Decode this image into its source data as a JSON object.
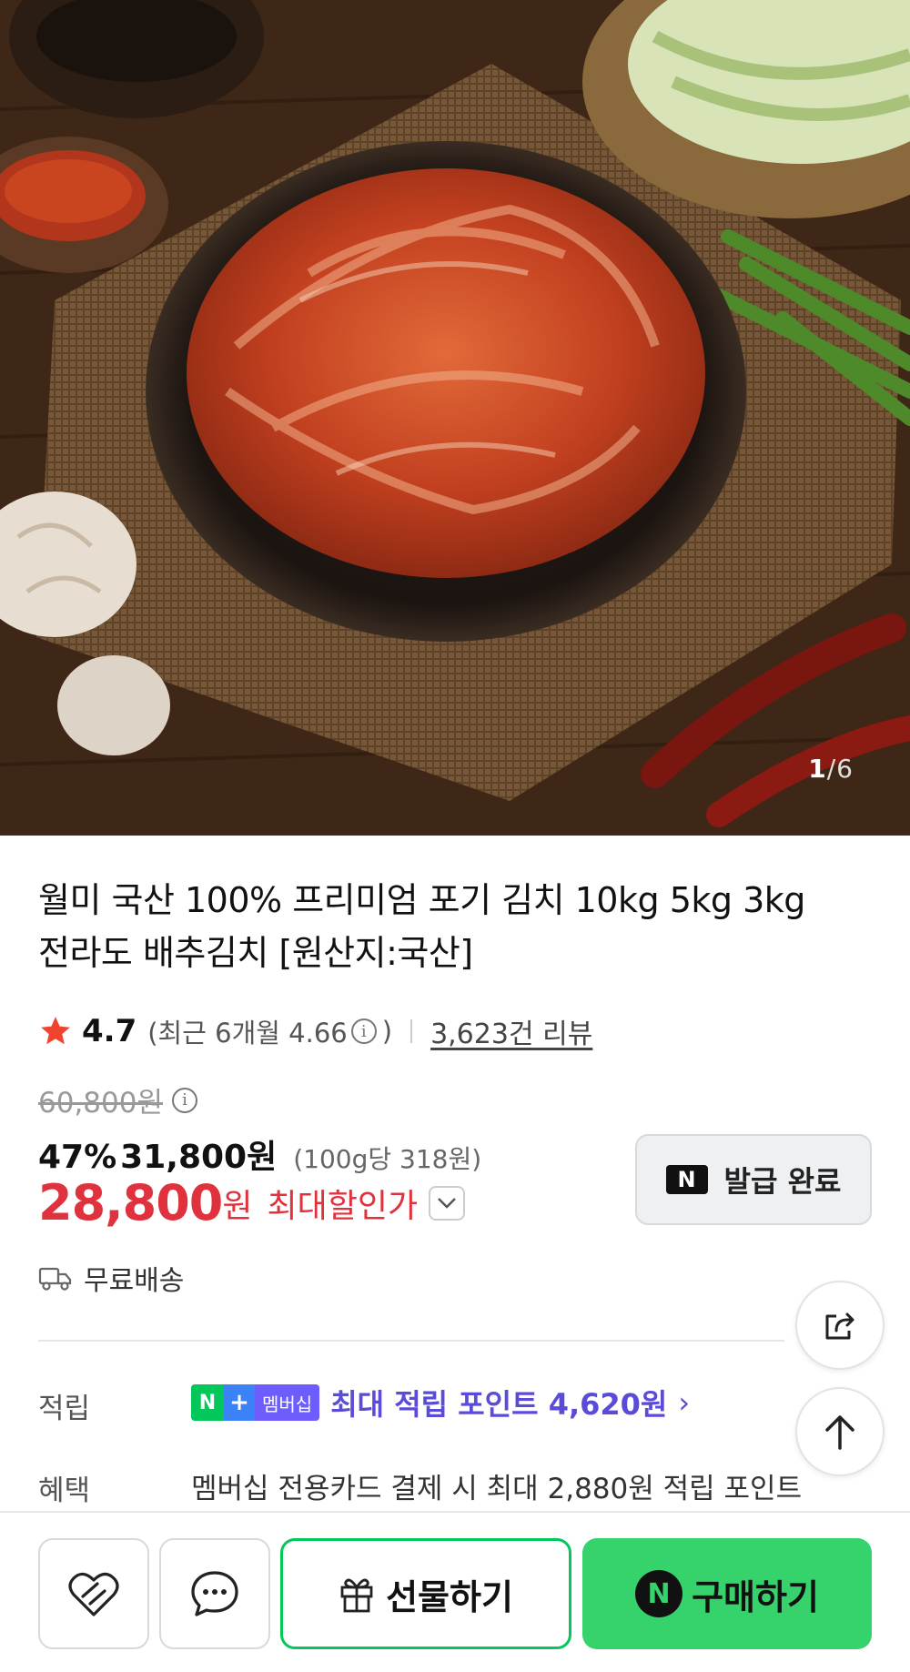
{
  "image": {
    "counter_current": "1",
    "counter_total": "/6"
  },
  "product": {
    "title_line1": "월미 국산 100% 프리미엄 포기 김치 10kg 5kg 3kg",
    "title_line2": "전라도 배추김치 [원산지:국산]"
  },
  "rating": {
    "value": "4.7",
    "recent_prefix": "(최근 6개월 4.66",
    "recent_suffix": ")",
    "reviews": "3,623건 리뷰"
  },
  "price": {
    "original": "60,800원",
    "discount_pct": "47%",
    "sale": "31,800원",
    "unit": "(100g당 318원)",
    "final": "28,800",
    "final_won": "원",
    "final_label": "최대할인가"
  },
  "coupon": {
    "badge": "N",
    "label": "발급 완료"
  },
  "shipping": {
    "label": "무료배송"
  },
  "points": {
    "label": "적립",
    "badge_n": "N",
    "badge_plus": "+",
    "badge_membership": "멤버십",
    "text": "최대 적립 포인트 4,620원",
    "chevron": "›"
  },
  "benefit": {
    "label": "혜택",
    "text": "멤버십 전용카드 결제 시 최대 2,880원 적립 포인트"
  },
  "bottom_bar": {
    "gift_label": "선물하기",
    "buy_badge": "N",
    "buy_label": "구매하기"
  },
  "icons": {
    "like": "heart-icon",
    "talk": "chat-icon",
    "gift": "gift-icon",
    "share": "share-icon",
    "top": "arrow-up-icon",
    "shipping": "truck-icon",
    "info": "info-icon",
    "star": "star-icon",
    "dropdown": "chevron-down-icon"
  },
  "colors": {
    "accent_red": "#e0323e",
    "naver_green": "#03c75a",
    "buy_green": "#36d36c",
    "points_purple": "#5a4bd9"
  }
}
